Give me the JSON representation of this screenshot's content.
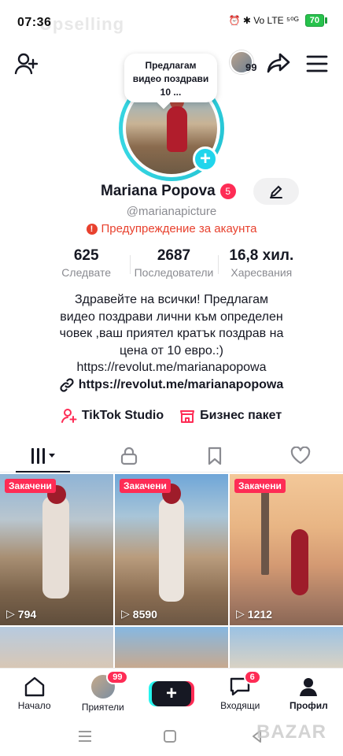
{
  "status_bar": {
    "time": "07:36",
    "ghost_text": "Upselling",
    "indicators": "⏰ ✱ Vo LTE ⁵⁰ᴳ",
    "battery": "70"
  },
  "header": {
    "mini_avatar_count": "99"
  },
  "note": {
    "text": "Предлагам видео поздрави 10 ..."
  },
  "profile": {
    "name": "Mariana Popova",
    "name_badge": "5",
    "handle": "@marianapicture",
    "warning": "Предупреждение за акаунта",
    "stats": [
      {
        "value": "625",
        "label": "Следвате"
      },
      {
        "value": "2687",
        "label": "Последователи"
      },
      {
        "value": "16,8 хил.",
        "label": "Харесвания"
      }
    ],
    "bio_line1": "Здравейте на всички! Предлагам",
    "bio_line2": "видео поздрави лични към определен",
    "bio_line3": "човек ,ваш приятел кратък поздрав на",
    "bio_line4": "цена от 10 евро.:)",
    "bio_line5": "https://revolut.me/marianapopowa",
    "link": "https://revolut.me/marianapopowa",
    "tools": {
      "studio": "TikTok Studio",
      "business": "Бизнес пакет"
    }
  },
  "tabs": [
    "videos-grid",
    "private-lock",
    "saved-bookmark",
    "liked-heart"
  ],
  "videos": [
    {
      "pinned": "Закачени",
      "views": "794"
    },
    {
      "pinned": "Закачени",
      "views": "8590"
    },
    {
      "pinned": "Закачени",
      "views": "1212"
    },
    {
      "pinned": "",
      "views": ""
    },
    {
      "pinned": "",
      "views": ""
    },
    {
      "pinned": "",
      "views": ""
    }
  ],
  "bottom_nav": {
    "home": "Начало",
    "friends": "Приятели",
    "friends_badge": "99",
    "inbox": "Входящи",
    "inbox_badge": "6",
    "profile": "Профил"
  },
  "watermark": "BAZAR",
  "colors": {
    "accent_red": "#fe2c55",
    "ring_cyan": "#33d1de",
    "warning": "#e8412e"
  }
}
